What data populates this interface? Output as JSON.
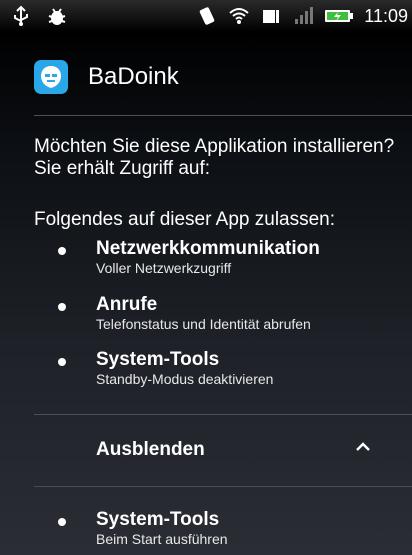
{
  "status_bar": {
    "time": "11:09",
    "left_icons": [
      "usb-icon",
      "debug-icon"
    ],
    "right_icons": [
      "vibrate-icon",
      "wifi-icon",
      "battery-icon",
      "signal-icon",
      "battery-charging-icon"
    ]
  },
  "app": {
    "name": "BaDoink",
    "icon": "badoink-app-icon",
    "accent_color": "#2aa7e8"
  },
  "prompt": "Möchten Sie diese Applikation installieren? Sie erhält Zugriff auf:",
  "permissions_heading": "Folgendes auf dieser App zulassen:",
  "permissions": [
    {
      "title": "Netzwerkkommunikation",
      "subtitle": "Voller Netzwerkzugriff"
    },
    {
      "title": "Anrufe",
      "subtitle": "Telefonstatus und Identität abrufen"
    },
    {
      "title": "System-Tools",
      "subtitle": "Standby-Modus deaktivieren"
    }
  ],
  "collapse": {
    "label": "Ausblenden",
    "icon": "chevron-up-icon"
  },
  "extra_permissions": [
    {
      "title": "System-Tools",
      "subtitle": "Beim Start ausführen"
    }
  ]
}
